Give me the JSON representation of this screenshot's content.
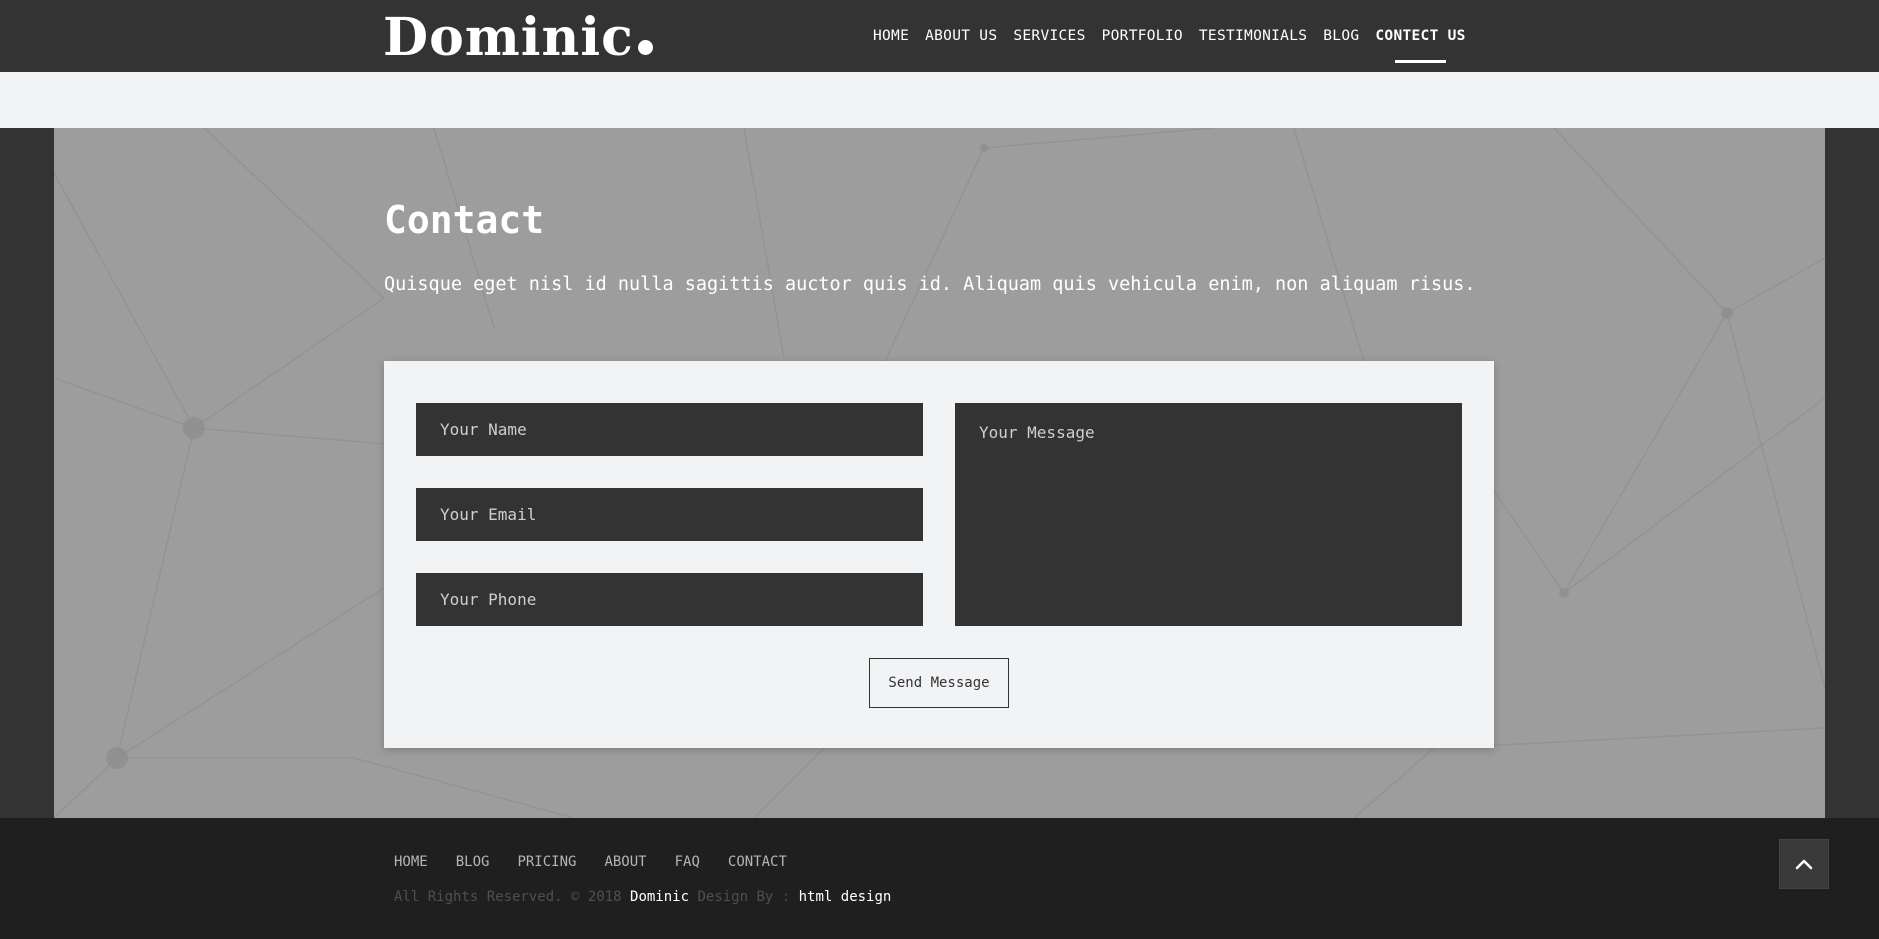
{
  "brand": {
    "logo_text": "Dominic"
  },
  "nav": {
    "items": [
      {
        "label": "HOME"
      },
      {
        "label": "ABOUT US"
      },
      {
        "label": "SERVICES"
      },
      {
        "label": "PORTFOLIO"
      },
      {
        "label": "TESTIMONIALS"
      },
      {
        "label": "BLOG"
      },
      {
        "label": "CONTECT US",
        "active": true
      }
    ]
  },
  "contact": {
    "title": "Contact",
    "description": "Quisque eget nisl id nulla sagittis auctor quis id. Aliquam quis vehicula enim, non aliquam risus.",
    "form": {
      "name_placeholder": "Your Name",
      "email_placeholder": "Your Email",
      "phone_placeholder": "Your Phone",
      "message_placeholder": "Your Message",
      "name_value": "",
      "email_value": "",
      "phone_value": "",
      "message_value": "",
      "submit_label": "Send Message"
    }
  },
  "footer": {
    "links": [
      {
        "label": "HOME"
      },
      {
        "label": "BLOG"
      },
      {
        "label": "PRICING"
      },
      {
        "label": "ABOUT"
      },
      {
        "label": "FAQ"
      },
      {
        "label": "CONTACT"
      }
    ],
    "copyright_prefix": "All Rights Reserved. © 2018",
    "copyright_brand": "Dominic",
    "copyright_middle": "Design By :",
    "copyright_designer": "html design"
  },
  "icons": {
    "back_to_top": "chevron-up-icon"
  },
  "colors": {
    "header_bg": "#333333",
    "section_bg": "#9d9d9d",
    "card_bg": "#f2f3f5",
    "field_bg": "#333333",
    "footer_bg": "#1f1f1f"
  }
}
